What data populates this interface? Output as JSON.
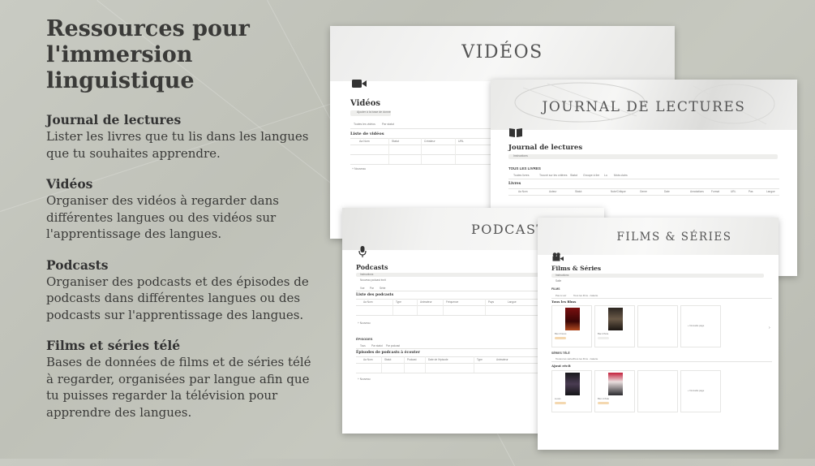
{
  "left": {
    "title_line1": "Ressources pour",
    "title_line2": "l'immersion",
    "title_line3": "linguistique",
    "sections": [
      {
        "heading": "Journal de lectures",
        "text": "Lister les livres que tu lis dans les langues que tu souhaites apprendre."
      },
      {
        "heading": "Vidéos",
        "text": "Organiser des vidéos à regarder dans différentes langues ou des vidéos sur l'apprentissage des langues."
      },
      {
        "heading": "Podcasts",
        "text": "Organiser des podcasts et des épisodes de podcasts dans différentes langues ou des podcasts sur l'apprentissage des langues."
      },
      {
        "heading": "Films et séries télé",
        "text": "Bases de données de films et de séries télé à regarder, organisées par langue afin que tu puisses regarder la télévision pour apprendre des langues."
      }
    ]
  },
  "videos": {
    "banner": "VIDÉOS",
    "heading": "Vidéos",
    "button": "Ajouter à la base de donné",
    "tab1": "Toutes les vidéos",
    "tab2": "Par statut",
    "list_title": "Liste de vidéos",
    "cols": [
      "Aa Nom",
      "Statut",
      "Créateur",
      "URL"
    ],
    "new": "+ Nouveau"
  },
  "journal": {
    "banner": "JOURNAL DE LECTURES",
    "heading": "Journal de lectures",
    "instr": "Instructions",
    "section": "TOUS LES LIVRES",
    "tabs": [
      "Toutes livres",
      "Trouvé sur les critères",
      "Statut",
      "Groupe à lire",
      "Lu",
      "Mots clairs"
    ],
    "list": "Livres",
    "cols": [
      "Aa Nom",
      "Auteur",
      "Statut",
      "Note/Critique",
      "Genre",
      "Date",
      "Annotations",
      "Format",
      "URL",
      "Pas",
      "Langue"
    ]
  },
  "podcasts": {
    "banner": "PODCASTS",
    "heading": "Podcasts",
    "instr": "Instructions",
    "button": "Nouveau podcast écrit",
    "tabs": [
      "Vue",
      "Par",
      "Série"
    ],
    "list1": "Liste des podcasts",
    "cols1": [
      "Aa Nom",
      "Type",
      "Animateur",
      "Fréquence",
      "Pays",
      "Langue"
    ],
    "section2": "ÉPISODES",
    "tabs2": [
      "Tous",
      "Par statut",
      "Par podcast"
    ],
    "list2": "Épisodes de podcasts à écouter",
    "cols2": [
      "Aa Nom",
      "Statut",
      "Podcast",
      "Date de l'épisode",
      "Type",
      "Animateur"
    ],
    "new": "+ Nouveau"
  },
  "films": {
    "banner": "FILMS & SÉRIES",
    "heading": "Films & Séries",
    "instr": "Instructions",
    "sub": "Salle",
    "section1": "FILMS",
    "tabs1": [
      "Pas à voir",
      "Tous les films - Galerie"
    ],
    "gallery1": "Tous les films",
    "cards1": [
      "Bien Frères",
      "Bac d'Aide"
    ],
    "new1": "+ Nouvelle page",
    "section2": "SÉRIES TÉLÉ",
    "tabs2": [
      "Toutes les séries",
      "Tous les films - Galerie"
    ],
    "gallery2": "Ajout récit",
    "cards2": [
      "Lucas",
      "Bien d'Aide"
    ],
    "new2": "+ Nouvelle page"
  },
  "colors": {
    "bg": "#c4c6bd",
    "text": "#3a3a38",
    "card": "#ffffff"
  }
}
